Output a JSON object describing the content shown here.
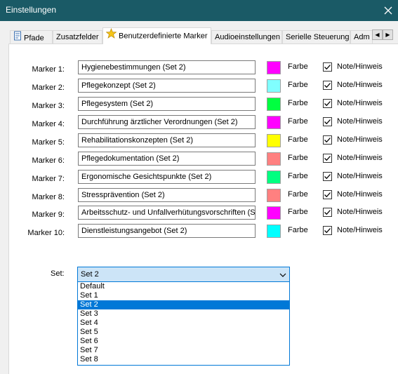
{
  "window": {
    "title": "Einstellungen"
  },
  "tabs": [
    {
      "label": "Pfade"
    },
    {
      "label": "Zusatzfelder"
    },
    {
      "label": "Benutzerdefinierte Marker"
    },
    {
      "label": "Audioeinstellungen"
    },
    {
      "label": "Serielle Steuerung"
    },
    {
      "label": "Adm"
    }
  ],
  "markers": [
    {
      "label": "Marker 1:",
      "value": "Hygienebestimmungen (Set 2)",
      "color": "#ff00ff",
      "color_label": "Farbe",
      "note_label": "Note/Hinweis",
      "note_checked": true
    },
    {
      "label": "Marker 2:",
      "value": "Pflegekonzept (Set 2)",
      "color": "#80ffff",
      "color_label": "Farbe",
      "note_label": "Note/Hinweis",
      "note_checked": true
    },
    {
      "label": "Marker 3:",
      "value": "Pflegesystem  (Set 2)",
      "color": "#00ff40",
      "color_label": "Farbe",
      "note_label": "Note/Hinweis",
      "note_checked": true
    },
    {
      "label": "Marker 4:",
      "value": "Durchführung ärztlicher Verordnungen (Set 2)",
      "color": "#ff00ff",
      "color_label": "Farbe",
      "note_label": "Note/Hinweis",
      "note_checked": true
    },
    {
      "label": "Marker 5:",
      "value": "Rehabilitationskonzepten (Set 2)",
      "color": "#ffff00",
      "color_label": "Farbe",
      "note_label": "Note/Hinweis",
      "note_checked": true
    },
    {
      "label": "Marker 6:",
      "value": "Pflegedokumentation (Set 2)",
      "color": "#ff8080",
      "color_label": "Farbe",
      "note_label": "Note/Hinweis",
      "note_checked": true
    },
    {
      "label": "Marker 7:",
      "value": "Ergonomische Gesichtspunkte (Set 2)",
      "color": "#00ff80",
      "color_label": "Farbe",
      "note_label": "Note/Hinweis",
      "note_checked": true
    },
    {
      "label": "Marker 8:",
      "value": "Stressprävention (Set 2)",
      "color": "#ff8080",
      "color_label": "Farbe",
      "note_label": "Note/Hinweis",
      "note_checked": true
    },
    {
      "label": "Marker 9:",
      "value": "Arbeitsschutz- und Unfallverhütungsvorschriften (Set",
      "color": "#ff00ff",
      "color_label": "Farbe",
      "note_label": "Note/Hinweis",
      "note_checked": true
    },
    {
      "label": "Marker 10:",
      "value": "Dienstleistungsangebot (Set 2)",
      "color": "#00ffff",
      "color_label": "Farbe",
      "note_label": "Note/Hinweis",
      "note_checked": true
    }
  ],
  "set_selector": {
    "label": "Set:",
    "value": "Set 2",
    "options": [
      "Default",
      "Set 1",
      "Set 2",
      "Set 3",
      "Set 4",
      "Set 5",
      "Set 6",
      "Set 7",
      "Set 8"
    ],
    "selected": "Set 2"
  },
  "icons": {
    "close": "close-icon",
    "pfade": "page-icon",
    "active_tab": "star-icon",
    "scroll_left": "arrow-left-icon",
    "scroll_right": "arrow-right-icon",
    "dropdown": "chevron-down-icon",
    "checkbox": "check-icon"
  },
  "colors": {
    "titlebar": "#1a5a66",
    "accent": "#0078d7"
  }
}
